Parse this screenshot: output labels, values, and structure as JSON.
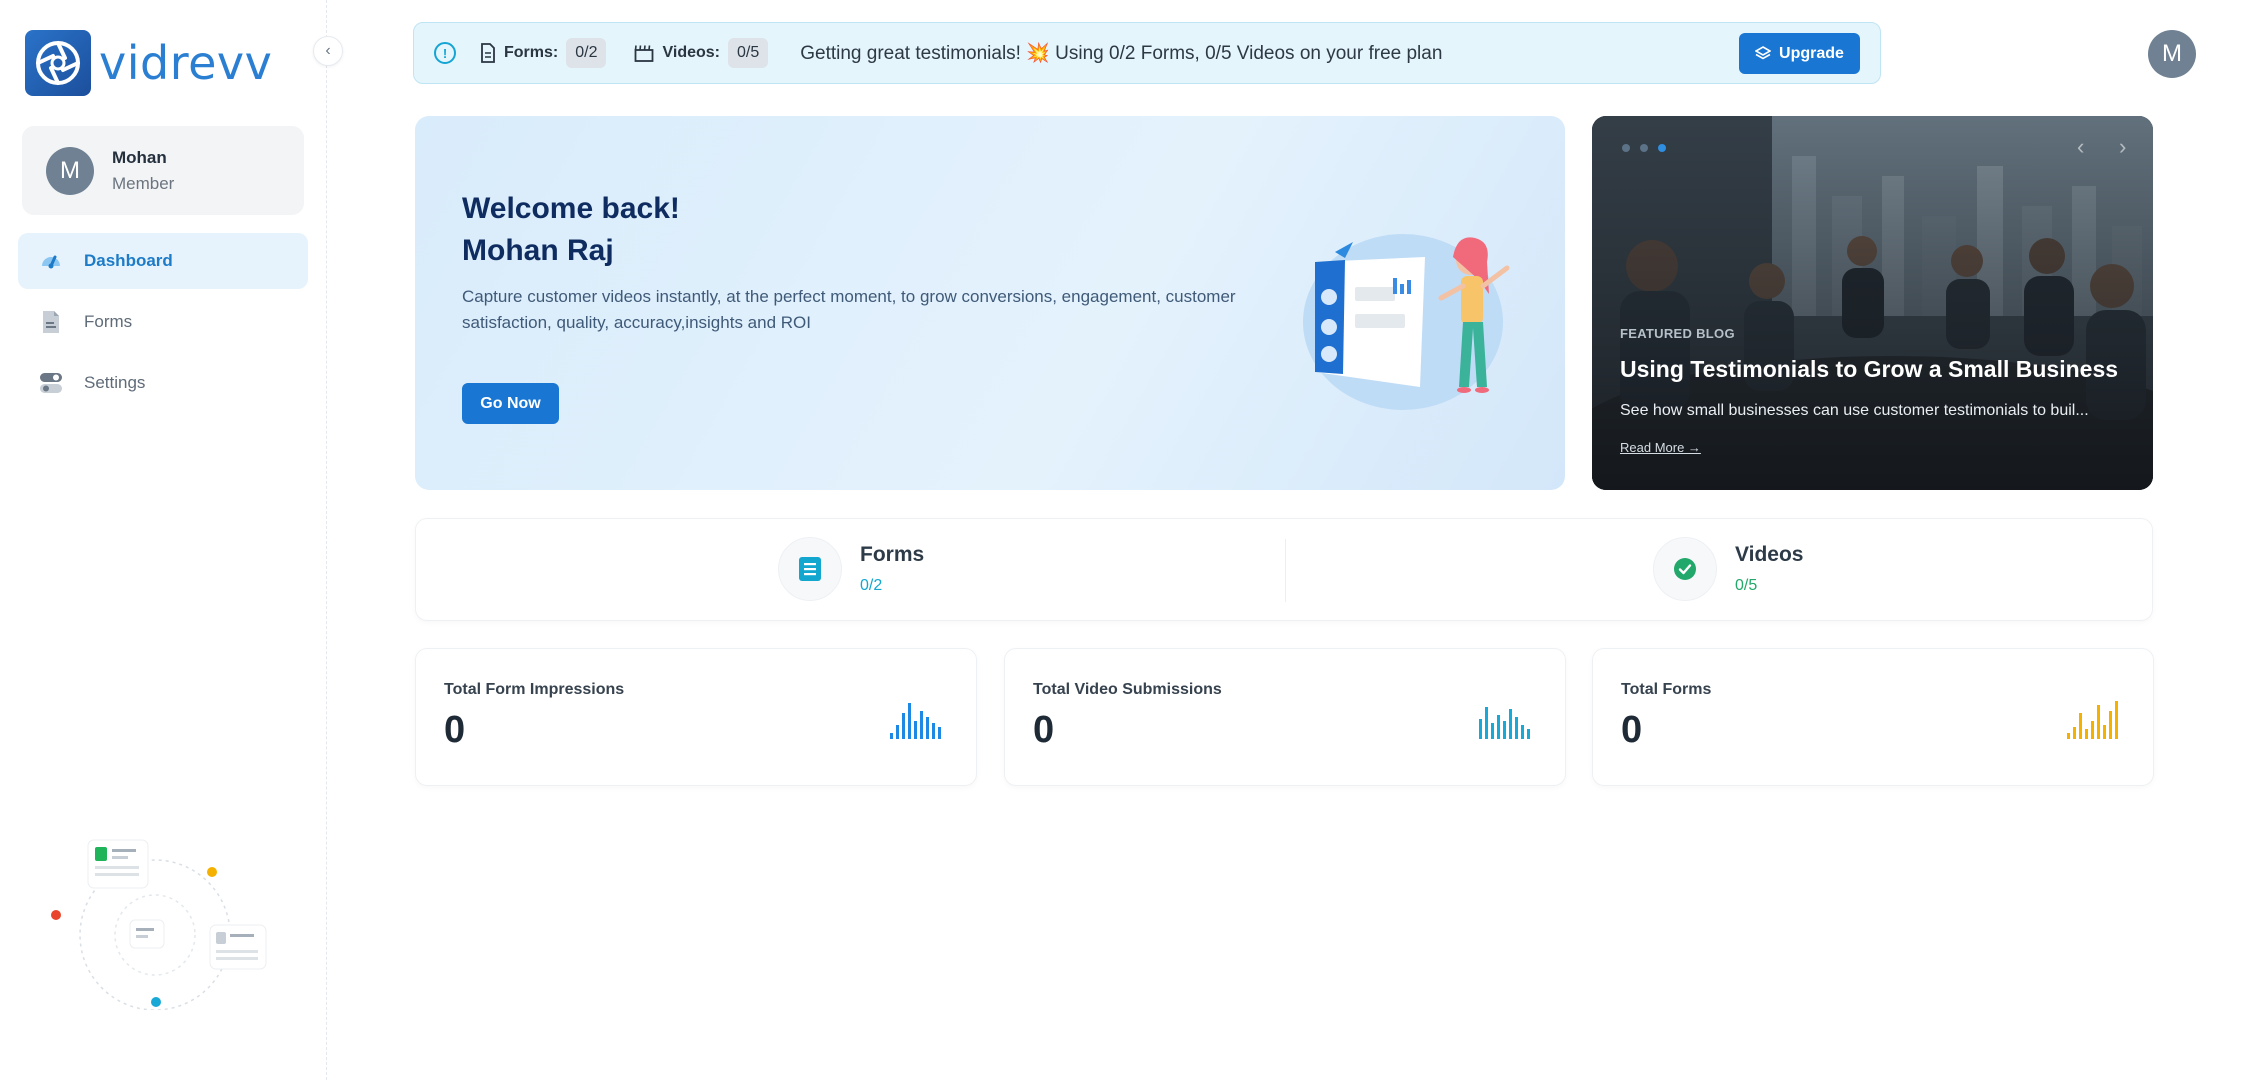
{
  "brand": {
    "name": "vidrevv"
  },
  "sidebar": {
    "user": {
      "initial": "M",
      "name": "Mohan",
      "role": "Member"
    },
    "items": [
      {
        "label": "Dashboard",
        "icon": "dashboard-gauge-icon",
        "active": true
      },
      {
        "label": "Forms",
        "icon": "document-icon",
        "active": false
      },
      {
        "label": "Settings",
        "icon": "toggle-settings-icon",
        "active": false
      }
    ]
  },
  "plan_banner": {
    "forms_label": "Forms:",
    "forms_count": "0/2",
    "videos_label": "Videos:",
    "videos_count": "0/5",
    "message": "Getting great testimonials! 💥 Using 0/2 Forms, 0/5 Videos on your free plan",
    "upgrade_label": "Upgrade"
  },
  "header": {
    "avatar_initial": "M"
  },
  "welcome": {
    "line1": "Welcome back!",
    "line2": "Mohan Raj",
    "description": "Capture customer videos instantly, at the perfect moment, to grow conversions, engagement, customer satisfaction, quality, accuracy,insights and ROI",
    "button_label": "Go Now"
  },
  "blog": {
    "tag": "FEATURED BLOG",
    "title": "Using Testimonials to Grow a Small Business",
    "description": "See how small businesses can use customer testimonials to buil...",
    "link_label": "Read More →",
    "slide_index": 3,
    "slide_count": 3
  },
  "counters": [
    {
      "label": "Forms",
      "value": "0/2",
      "color": "#13a6cf"
    },
    {
      "label": "Videos",
      "value": "0/5",
      "color": "#22a86a"
    }
  ],
  "stats": [
    {
      "label": "Total Form Impressions",
      "value": "0",
      "color": "#1e88e5"
    },
    {
      "label": "Total Video Submissions",
      "value": "0",
      "color": "#1aa9d6"
    },
    {
      "label": "Total Forms",
      "value": "0",
      "color": "#f5b100"
    }
  ]
}
